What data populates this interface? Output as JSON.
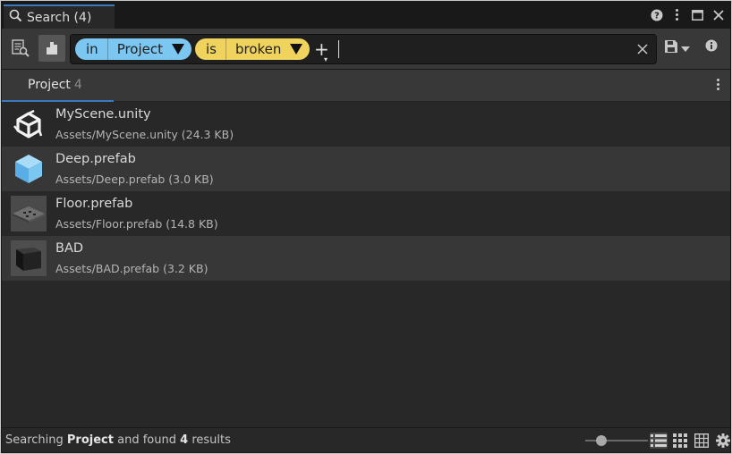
{
  "window": {
    "title": "Search (4)"
  },
  "query": {
    "chips": [
      {
        "key": "in",
        "value": "Project",
        "color": "#7cc6f2"
      },
      {
        "key": "is",
        "value": "broken",
        "color": "#f0d35d"
      }
    ],
    "text": ""
  },
  "tabs": [
    {
      "label": "Project",
      "count": "4"
    }
  ],
  "results": [
    {
      "name": "MyScene.unity",
      "description": "Assets/MyScene.unity (24.3 KB)",
      "icon": "unity-scene-icon"
    },
    {
      "name": "Deep.prefab",
      "description": "Assets/Deep.prefab (3.0 KB)",
      "icon": "prefab-cube-icon"
    },
    {
      "name": "Floor.prefab",
      "description": "Assets/Floor.prefab (14.8 KB)",
      "icon": "floor-preview-icon"
    },
    {
      "name": "BAD",
      "description": "Assets/BAD.prefab (3.2 KB)",
      "icon": "dark-cube-icon"
    }
  ],
  "status": {
    "prefix": "Searching",
    "provider": "Project",
    "middle": "and found",
    "count": "4",
    "suffix": "results"
  },
  "item_size": 0.25,
  "colors": {
    "accent": "#3a79bb",
    "background": "#282828",
    "toolbar": "#383838"
  }
}
